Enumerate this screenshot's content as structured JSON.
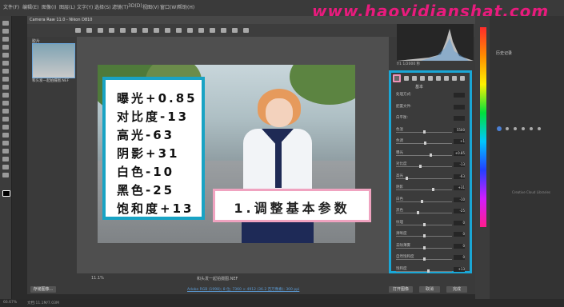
{
  "menubar": {
    "items": [
      "文件(F)",
      "编辑(E)",
      "图像(I)",
      "图层(L)",
      "文字(Y)",
      "选择(S)",
      "滤镜(T)",
      "3D(D)",
      "视图(V)",
      "窗口(W)",
      "帮助(H)"
    ],
    "watermark": "www.haoyidianshat.com"
  },
  "camera_raw": {
    "title": "Camera Raw 11.0 - Nikon D810",
    "filmstrip": {
      "label": "胶片",
      "thumb_name": "和头发一起拍摄图.NEF"
    },
    "histogram_info": "f/1    1/2000 秒",
    "canvas_footer": {
      "zoom": "11.1%",
      "filename": "和头发一起拍摄图.NEF"
    },
    "overlay": {
      "adjustments": [
        "曝光+0.85",
        "对比度-13",
        "高光-63",
        "阴影+31",
        "白色-10",
        "黑色-25",
        "饱和度+13"
      ],
      "step_title": "1.调整基本参数"
    },
    "panel": {
      "title": "基本",
      "sliders": [
        {
          "label": "处理方式:",
          "value": ""
        },
        {
          "label": "配置文件:",
          "value": ""
        },
        {
          "label": "白平衡:",
          "value": ""
        },
        {
          "label": "色温",
          "value": "5500"
        },
        {
          "label": "色调",
          "value": "+1"
        },
        {
          "label": "曝光",
          "value": "+0.85"
        },
        {
          "label": "对比度",
          "value": "-13"
        },
        {
          "label": "高光",
          "value": "-63"
        },
        {
          "label": "阴影",
          "value": "+31"
        },
        {
          "label": "白色",
          "value": "-10"
        },
        {
          "label": "黑色",
          "value": "-25"
        },
        {
          "label": "纹理",
          "value": "0"
        },
        {
          "label": "清晰度",
          "value": "0"
        },
        {
          "label": "去除薄雾",
          "value": "0"
        },
        {
          "label": "自然饱和度",
          "value": "0"
        },
        {
          "label": "饱和度",
          "value": "+13"
        }
      ],
      "sliders_levels": [
        0,
        0,
        0,
        0.5,
        0.51,
        0.61,
        0.43,
        0.18,
        0.66,
        0.45,
        0.38,
        0.5,
        0.5,
        0.5,
        0.5,
        0.57
      ]
    },
    "footer_link": "Adobe RGB (1998); 8 位; 7360 × 4912 (36.2 百万像素); 300 ppi",
    "buttons": {
      "save": "存储图像...",
      "open": "打开图像",
      "cancel": "取消",
      "done": "完成"
    }
  },
  "ps_panel": {
    "title": "历史记录",
    "cc_text": "Creative Cloud Libraries"
  },
  "status": {
    "zoom": "66.67%",
    "doc": "文档:11.1M/7.03M"
  },
  "colors": {
    "accent_box": "#19a3c4",
    "pink_border": "#f0a3c0",
    "watermark": "#e81b7d"
  }
}
